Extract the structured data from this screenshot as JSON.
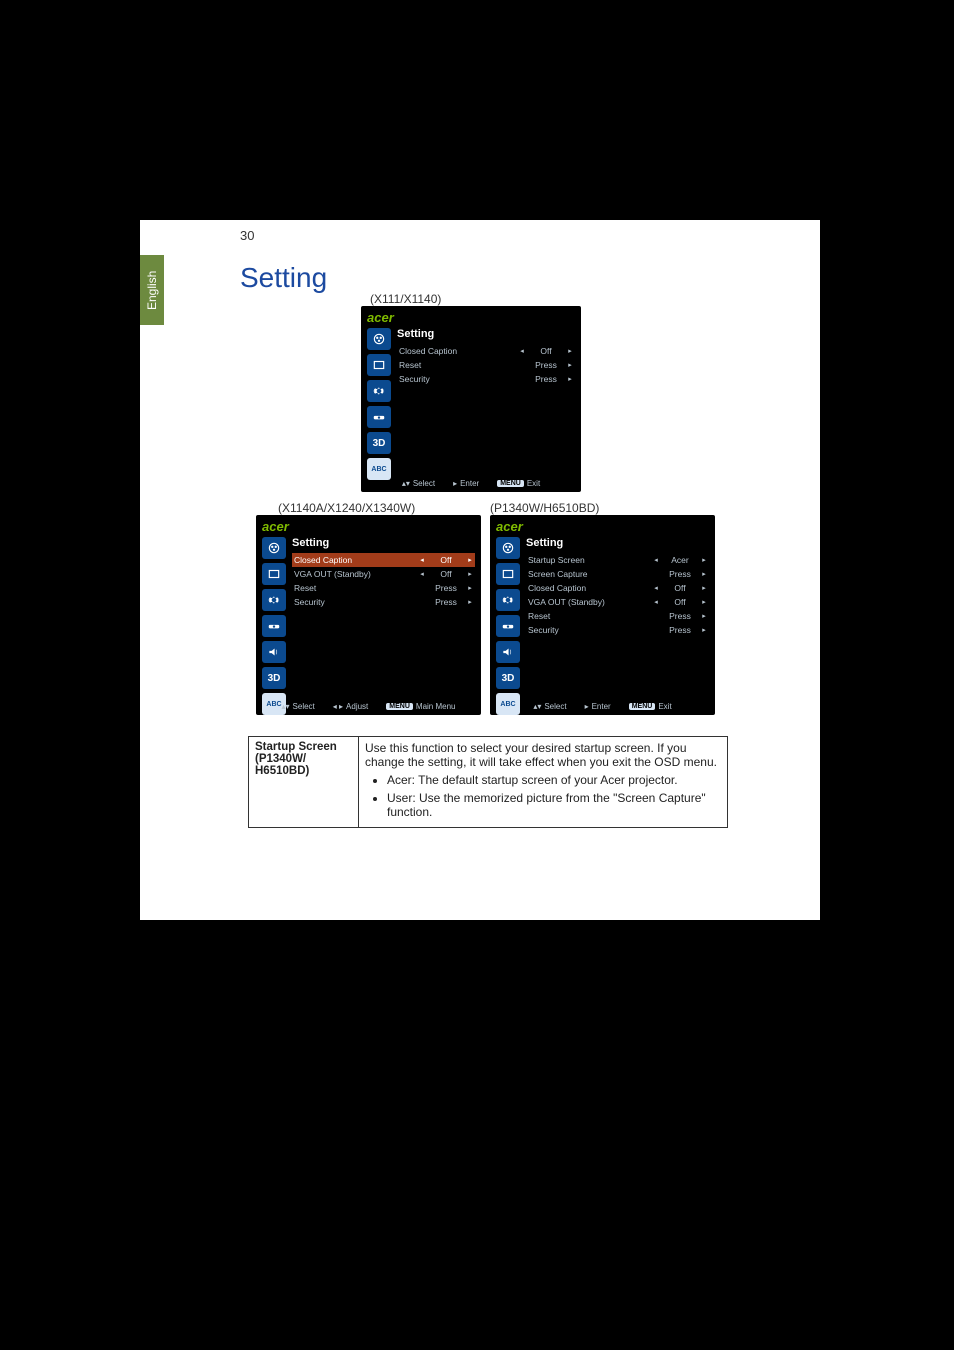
{
  "sidetab": "English",
  "page_number": "30",
  "heading": "Setting",
  "labels": {
    "model1": "(X111/X1140)",
    "model2": "(X1140A/X1240/X1340W)",
    "model3": "(P1340W/H6510BD)"
  },
  "brand": "acer",
  "panel_title": "Setting",
  "osd1": {
    "rows": [
      {
        "label": "Closed Caption",
        "left": "◂",
        "value": "Off",
        "right": "▸"
      },
      {
        "label": "Reset",
        "left": "",
        "value": "Press",
        "right": "▸"
      },
      {
        "label": "Security",
        "left": "",
        "value": "Press",
        "right": "▸"
      }
    ],
    "footer": {
      "a": "▴▾",
      "a_lbl": "Select",
      "b": "▸",
      "b_lbl": "Enter",
      "c_badge": "MENU",
      "c_lbl": "Exit"
    }
  },
  "osd2": {
    "rows": [
      {
        "label": "Closed Caption",
        "left": "◂",
        "value": "Off",
        "right": "▸",
        "hl": true
      },
      {
        "label": "VGA OUT (Standby)",
        "left": "◂",
        "value": "Off",
        "right": "▸"
      },
      {
        "label": "Reset",
        "left": "",
        "value": "Press",
        "right": "▸"
      },
      {
        "label": "Security",
        "left": "",
        "value": "Press",
        "right": "▸"
      }
    ],
    "footer": {
      "a": "▴▾",
      "a_lbl": "Select",
      "b": "◂ ▸",
      "b_lbl": "Adjust",
      "c_badge": "MENU",
      "c_lbl": "Main Menu"
    }
  },
  "osd3": {
    "rows": [
      {
        "label": "Startup Screen",
        "left": "◂",
        "value": "Acer",
        "right": "▸"
      },
      {
        "label": "Screen Capture",
        "left": "",
        "value": "Press",
        "right": "▸"
      },
      {
        "label": "Closed Caption",
        "left": "◂",
        "value": "Off",
        "right": "▸"
      },
      {
        "label": "VGA OUT (Standby)",
        "left": "◂",
        "value": "Off",
        "right": "▸"
      },
      {
        "label": "Reset",
        "left": "",
        "value": "Press",
        "right": "▸"
      },
      {
        "label": "Security",
        "left": "",
        "value": "Press",
        "right": "▸"
      }
    ],
    "footer": {
      "a": "▴▾",
      "a_lbl": "Select",
      "b": "▸",
      "b_lbl": "Enter",
      "c_badge": "MENU",
      "c_lbl": "Exit"
    }
  },
  "icons": {
    "abc": "ABC",
    "threeD": "3D"
  },
  "table": {
    "c1_line1": "Startup Screen",
    "c1_line2": "(P1340W/",
    "c1_line3": "H6510BD)",
    "intro": "Use this function to select your desired startup screen. If you change the setting, it will take effect when you exit the OSD menu.",
    "li1": "Acer: The default startup screen of your Acer projector.",
    "li2": "User: Use the memorized picture from the \"Screen Capture\" function."
  }
}
